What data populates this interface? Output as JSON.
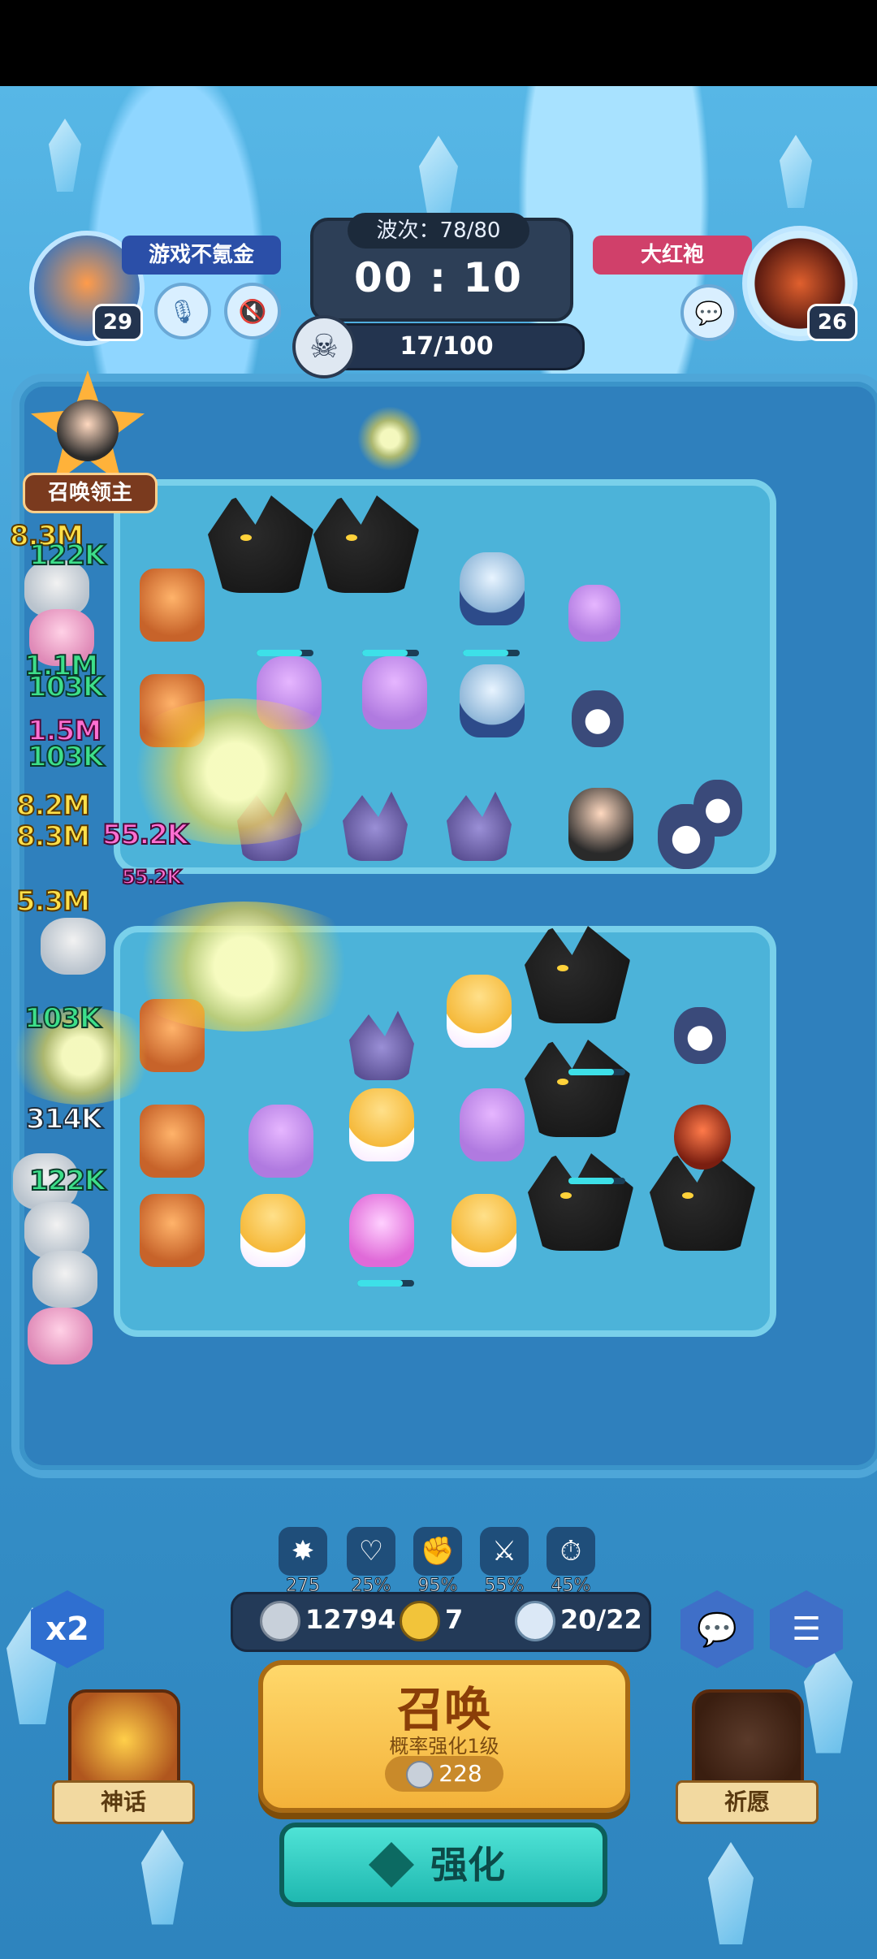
{
  "player_left": {
    "name": "游戏不氪金",
    "level": "29"
  },
  "player_right": {
    "name": "大红袍",
    "level": "26"
  },
  "wave": {
    "label": "波次：78/80",
    "timer": "00 : 10"
  },
  "kills": "17/100",
  "summon_lord": "召唤领主",
  "damage_numbers": [
    "8.3M",
    "122K",
    "1.1M",
    "103K",
    "1.5M",
    "103K",
    "8.2M",
    "55.2K",
    "8.3M",
    "55.2K",
    "5.3M",
    "103K",
    "314K",
    "122K"
  ],
  "stats": [
    "275",
    "25%",
    "95%",
    "55%",
    "45%"
  ],
  "resources": {
    "silver": "12794",
    "clover": "7",
    "units": "20/22"
  },
  "speed_button": "x2",
  "summon": {
    "title": "召唤",
    "subtitle": "概率强化1级",
    "cost": "228"
  },
  "upgrade": "强化",
  "left_chest": "神话",
  "right_chest": "祈愿",
  "colors": {
    "summon_gold": "#f3b23a",
    "upgrade_teal": "#1fb8b0",
    "hud_navy": "#23344f",
    "name_left": "#2b4fa8",
    "name_right": "#d0406a"
  }
}
